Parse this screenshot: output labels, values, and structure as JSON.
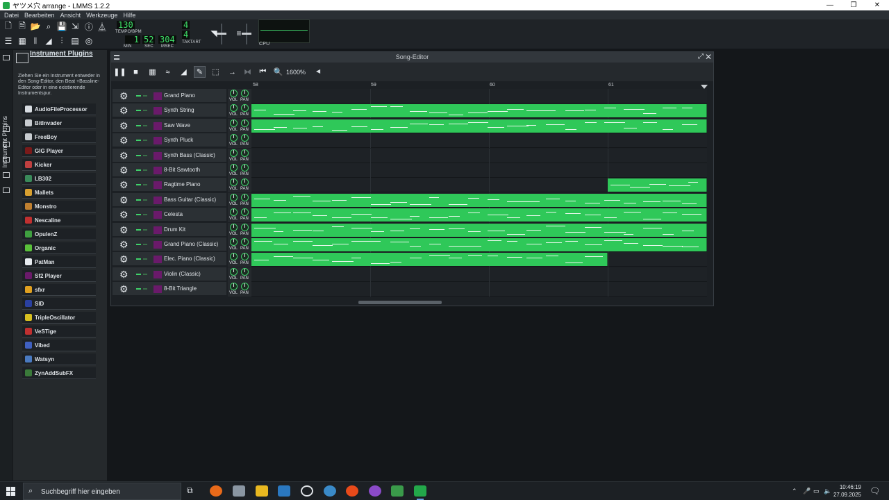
{
  "window": {
    "title": "ヤツメ穴 arrange - LMMS 1.2.2",
    "minimize": "—",
    "maximize": "❐",
    "close": "✕"
  },
  "menu": [
    "Datei",
    "Bearbeiten",
    "Ansicht",
    "Werkzeuge",
    "Hilfe"
  ],
  "toolbar": {
    "tempo": "130",
    "tempo_label": "TEMPO/BPM",
    "time_min": "1",
    "time_sec": "52",
    "time_msec": "304",
    "label_min": "MIN",
    "label_sec": "SEC",
    "label_msec": "MSEC",
    "ts_num": "4",
    "ts_den": "4",
    "ts_label": "TAKTART",
    "cpu_label": "CPU"
  },
  "sidebar": {
    "vertical_tab": "Instrument Plugins",
    "title": "Instrument Plugins",
    "hint": "Ziehen Sie ein Instrument entweder in den Song-Editor, den Beat +Bassline-Editor oder in eine existierende Instrumentspur.",
    "plugins": [
      {
        "label": "AudioFileProcessor",
        "color": "#d8dde2"
      },
      {
        "label": "BitInvader",
        "color": "#c8ccd0"
      },
      {
        "label": "FreeBoy",
        "color": "#c8ccd0"
      },
      {
        "label": "GIG Player",
        "color": "#7a1a1a"
      },
      {
        "label": "Kicker",
        "color": "#c04040"
      },
      {
        "label": "LB302",
        "color": "#3a8a5a"
      },
      {
        "label": "Mallets",
        "color": "#d8a030"
      },
      {
        "label": "Monstro",
        "color": "#c08030"
      },
      {
        "label": "Nescaline",
        "color": "#c03030"
      },
      {
        "label": "OpulenZ",
        "color": "#3fa040"
      },
      {
        "label": "Organic",
        "color": "#5ac03a"
      },
      {
        "label": "PatMan",
        "color": "#e8ecf0"
      },
      {
        "label": "Sf2 Player",
        "color": "#6a1a6a"
      },
      {
        "label": "sfxr",
        "color": "#e0a020"
      },
      {
        "label": "SID",
        "color": "#2a40a0"
      },
      {
        "label": "TripleOscillator",
        "color": "#d8c020"
      },
      {
        "label": "VeSTige",
        "color": "#c03030"
      },
      {
        "label": "Vibed",
        "color": "#4060c0"
      },
      {
        "label": "Watsyn",
        "color": "#4a7ac0"
      },
      {
        "label": "ZynAddSubFX",
        "color": "#3a7a3a"
      }
    ]
  },
  "song_editor": {
    "title": "Song-Editor",
    "zoom": "1600%",
    "bars": [
      "58",
      "59",
      "60",
      "61"
    ],
    "knob_vol": "VOL",
    "knob_pan": "PAN",
    "tracks": [
      {
        "name": "Grand Piano",
        "patterns": []
      },
      {
        "name": "Synth String",
        "patterns": [
          [
            0,
            4
          ]
        ]
      },
      {
        "name": "Saw Wave",
        "patterns": [
          [
            0,
            4
          ]
        ]
      },
      {
        "name": "Synth Pluck",
        "patterns": []
      },
      {
        "name": "Synth Bass (Classic)",
        "patterns": []
      },
      {
        "name": "8-Bit Sawtooth",
        "patterns": []
      },
      {
        "name": "Ragtime Piano",
        "patterns": [
          [
            3,
            4
          ]
        ]
      },
      {
        "name": "Bass Guitar (Classic)",
        "patterns": [
          [
            0,
            4
          ]
        ]
      },
      {
        "name": "Celesta",
        "patterns": [
          [
            0,
            4
          ]
        ]
      },
      {
        "name": "Drum Kit",
        "patterns": [
          [
            0,
            4
          ]
        ]
      },
      {
        "name": "Grand Piano (Classic)",
        "patterns": [
          [
            0,
            4
          ]
        ]
      },
      {
        "name": "Elec. Piano (Classic)",
        "patterns": [
          [
            0,
            3
          ]
        ]
      },
      {
        "name": "Violin (Classic)",
        "patterns": []
      },
      {
        "name": "8-Bit Triangle",
        "patterns": []
      }
    ]
  },
  "taskbar": {
    "search_placeholder": "Suchbegriff hier eingeben",
    "time": "10:46:19",
    "date": "27.09.2025"
  }
}
